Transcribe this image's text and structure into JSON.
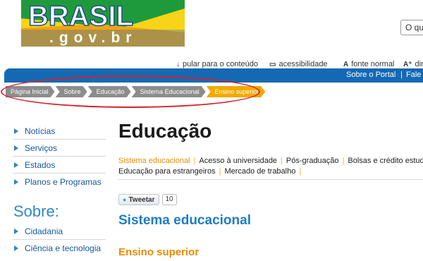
{
  "header": {
    "logo_text": "BRASIL",
    "logo_domain": ".gov.br",
    "search_placeholder": "O que"
  },
  "utility": {
    "skip": "pular para o conteúdo",
    "accessibility": "acessibilidade",
    "font_normal": "fonte normal",
    "increase_font": "dim"
  },
  "topbar": {
    "about": "Sobre o Portal",
    "contact": "Fale co"
  },
  "breadcrumb": [
    "Página Inicial",
    "Sobre",
    "Educação",
    "Sistema Educacional",
    "Ensino superior"
  ],
  "sidebar": {
    "main_items": [
      "Notícias",
      "Serviços",
      "Estados",
      "Planos e Programas"
    ],
    "sobre_heading": "Sobre:",
    "sobre_items": [
      "Cidadania",
      "Ciência e tecnologia"
    ]
  },
  "main": {
    "title": "Educação",
    "subnav_row1": [
      "Sistema educacional",
      "Acesso à universidade",
      "Pós-graduação",
      "Bolsas e crédito estudan"
    ],
    "subnav_row2": [
      "Educação para estrangeiros",
      "Mercado de trabalho"
    ],
    "tweet_label": "Tweetar",
    "tweet_count": "10",
    "section_title": "Sistema educacional",
    "subsection_title": "Ensino superior"
  },
  "colors": {
    "accent_blue": "#1569b3",
    "accent_orange": "#e98b00",
    "logo_green": "#1e9a3c",
    "logo_yellow": "#f7d417"
  }
}
